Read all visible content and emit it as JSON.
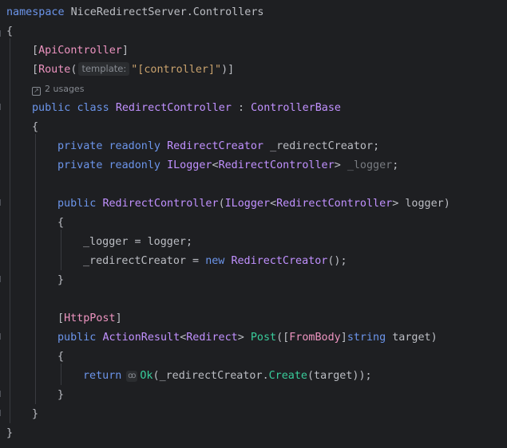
{
  "code": {
    "l1": {
      "kw": "namespace",
      "name": "NiceRedirectServer.Controllers"
    },
    "l2": {
      "brace": "{"
    },
    "l3": {
      "open": "[",
      "attr": "ApiController",
      "close": "]"
    },
    "l4": {
      "open": "[",
      "attr": "Route",
      "paren": "(",
      "hint": "template:",
      "str": "\"[controller]\"",
      "close": ")]"
    },
    "l5": {
      "usages": "2 usages"
    },
    "l6": {
      "kw1": "public",
      "kw2": "class",
      "name": "RedirectController",
      "colon": " : ",
      "base": "ControllerBase"
    },
    "l7": {
      "brace": "{"
    },
    "l8": {
      "kw1": "private",
      "kw2": "readonly",
      "type": "RedirectCreator",
      "field": "_redirectCreator",
      "semi": ";"
    },
    "l9": {
      "kw1": "private",
      "kw2": "readonly",
      "type": "ILogger",
      "lt": "<",
      "targ": "RedirectController",
      "gt": ">",
      "field": "_logger",
      "semi": ";"
    },
    "l10": {
      "kw": "public",
      "name": "RedirectController",
      "p1": "(",
      "type": "ILogger",
      "lt": "<",
      "targ": "RedirectController",
      "gt": ">",
      "param": " logger)"
    },
    "l11": {
      "brace": "{"
    },
    "l12": {
      "field": "_logger",
      "rest": " = logger;"
    },
    "l13": {
      "field": "_redirectCreator",
      "eq": " = ",
      "kw": "new",
      "type": "RedirectCreator",
      "rest": "();"
    },
    "l14": {
      "brace": "}"
    },
    "l15": {
      "open": "[",
      "attr": "HttpPost",
      "close": "]"
    },
    "l16": {
      "kw": "public",
      "type": "ActionResult",
      "lt": "<",
      "targ": "Redirect",
      "gt": ">",
      "method": "Post",
      "p1": "([",
      "attr": "FromBody",
      "p2": "]",
      "kw2": "string",
      "rest": " target)"
    },
    "l17": {
      "brace": "{"
    },
    "l18": {
      "kw": "return",
      "fn": "Ok",
      "p1": "(",
      "field": "_redirectCreator",
      "dot": ".",
      "fn2": "Create",
      "rest": "(target));"
    },
    "l19": {
      "brace": "}"
    },
    "l20": {
      "brace": "}"
    },
    "l21": {
      "brace": "}"
    }
  },
  "icons": {
    "usages": "external-link-icon",
    "hint": "hint-icon"
  }
}
